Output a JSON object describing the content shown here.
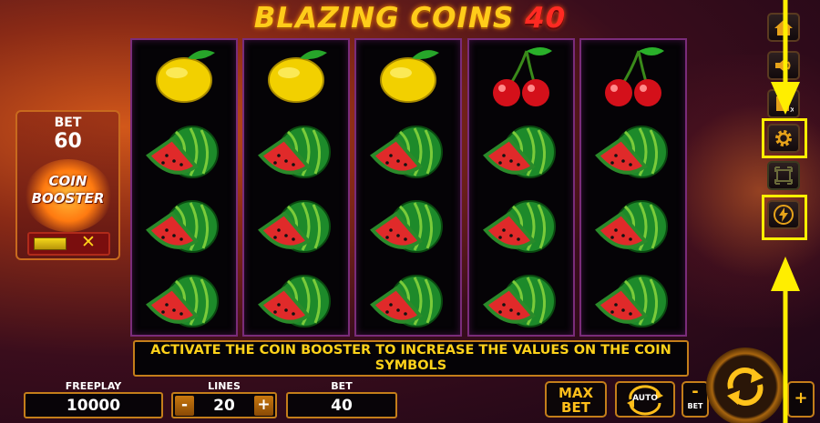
{
  "title": {
    "part1": "BLAZING COINS",
    "part2": "40"
  },
  "reels": [
    [
      "lemon",
      "watermelon",
      "watermelon",
      "watermelon"
    ],
    [
      "lemon",
      "watermelon",
      "watermelon",
      "watermelon"
    ],
    [
      "lemon",
      "watermelon",
      "watermelon",
      "watermelon"
    ],
    [
      "cherries",
      "watermelon",
      "watermelon",
      "watermelon"
    ],
    [
      "cherries",
      "watermelon",
      "watermelon",
      "watermelon"
    ]
  ],
  "bet_panel": {
    "label": "BET",
    "value": "60",
    "booster_line1": "COIN",
    "booster_line2": "BOOSTER",
    "toggle_off_symbol": "✕"
  },
  "message": "ACTIVATE THE COIN BOOSTER TO INCREASE THE VALUES ON THE COIN SYMBOLS",
  "bottom": {
    "freeplay_label": "FREEPLAY",
    "freeplay_value": "10000",
    "lines_label": "LINES",
    "lines_value": "20",
    "minus": "-",
    "plus": "+",
    "bet_label": "BET",
    "bet_value": "40",
    "maxbet_line1": "MAX",
    "maxbet_line2": "BET",
    "auto_label": "AUTO",
    "bet_minus_sign": "-",
    "bet_minus_label": "BET"
  },
  "side_buttons": [
    "home-icon",
    "sound-icon",
    "info-icon",
    "gear-icon",
    "fullscreen-icon",
    "lightning-icon"
  ],
  "colors": {
    "accent": "#ffd21a",
    "frame": "#c47e1a",
    "highlight": "#ffee00",
    "reel_border": "#7a2c7a"
  }
}
